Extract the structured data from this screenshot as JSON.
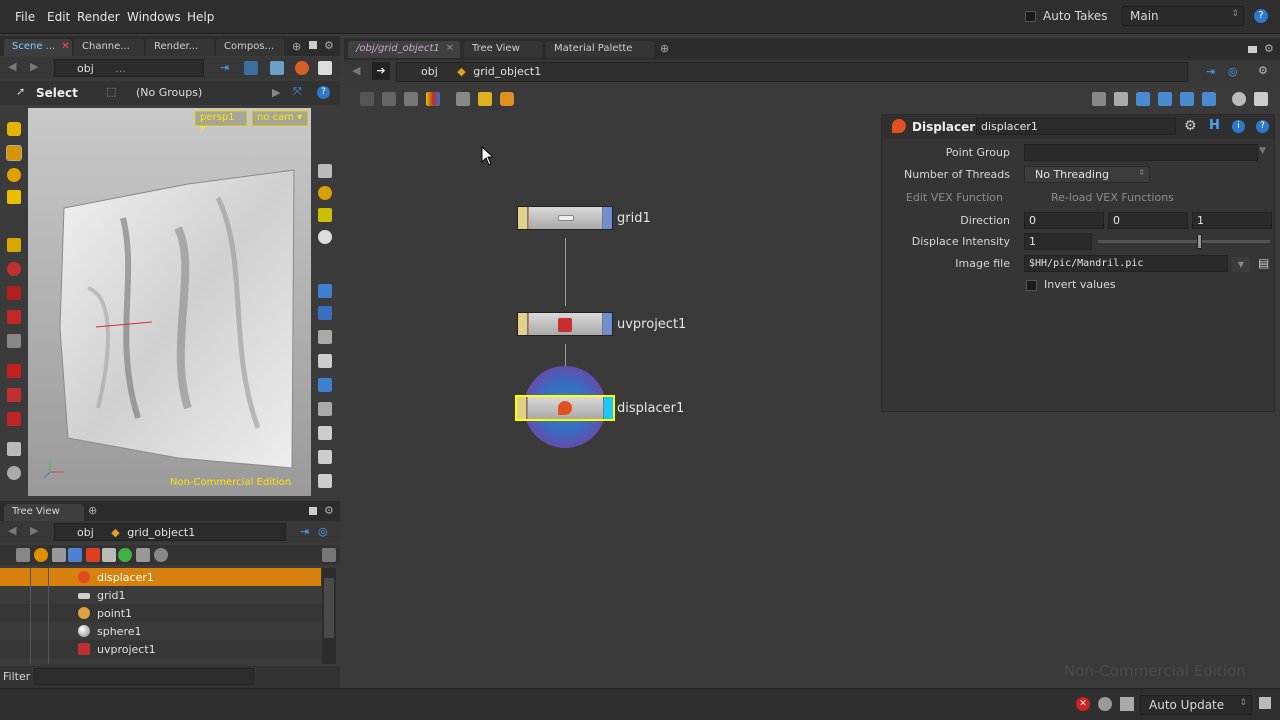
{
  "menubar": {
    "items": [
      "File",
      "Edit",
      "Render",
      "Windows",
      "Help"
    ],
    "auto_takes_label": "Auto Takes",
    "desktop": "Main"
  },
  "left_panel": {
    "tabs": [
      "Scene ...",
      "Channe...",
      "Render...",
      "Compos..."
    ],
    "path": "obj",
    "path_more": "...",
    "select_label": "Select",
    "groups": "(No Groups)"
  },
  "viewport": {
    "camera_menu": "persp1",
    "cam_menu": "no cam",
    "watermark": "Non-Commercial Edition"
  },
  "network_panel": {
    "tabs": [
      "/obj/grid_object1",
      "Tree View",
      "Material Palette"
    ],
    "path_root": "obj",
    "path_object": "grid_object1",
    "watermark": "Non-Commercial Edition",
    "nodes": [
      {
        "name": "grid1"
      },
      {
        "name": "uvproject1"
      },
      {
        "name": "displacer1"
      }
    ]
  },
  "parameters": {
    "node_type": "Displacer",
    "node_name": "displacer1",
    "point_group_label": "Point Group",
    "point_group_value": "",
    "threads_label": "Number of Threads",
    "threads_value": "No Threading",
    "edit_vex_label": "Edit VEX Function",
    "reload_vex_label": "Re-load VEX Functions",
    "direction_label": "Direction",
    "direction": [
      "0",
      "0",
      "1"
    ],
    "intensity_label": "Displace Intensity",
    "intensity_value": "1",
    "intensity_fraction": 0.59,
    "image_file_label": "Image file",
    "image_file_value": "$HH/pic/Mandril.pic",
    "invert_label": "Invert values"
  },
  "tree_view": {
    "title": "Tree View",
    "path_root": "obj",
    "path_object": "grid_object1",
    "rows": [
      {
        "name": "displacer1",
        "selected": true,
        "icon": "displacer-icon"
      },
      {
        "name": "grid1",
        "selected": false,
        "icon": "grid-icon"
      },
      {
        "name": "point1",
        "selected": false,
        "icon": "point-icon"
      },
      {
        "name": "sphere1",
        "selected": false,
        "icon": "sphere-icon"
      },
      {
        "name": "uvproject1",
        "selected": false,
        "icon": "uvproject-icon"
      }
    ],
    "filter_label": "Filter"
  },
  "statusbar": {
    "update_mode": "Auto Update"
  }
}
